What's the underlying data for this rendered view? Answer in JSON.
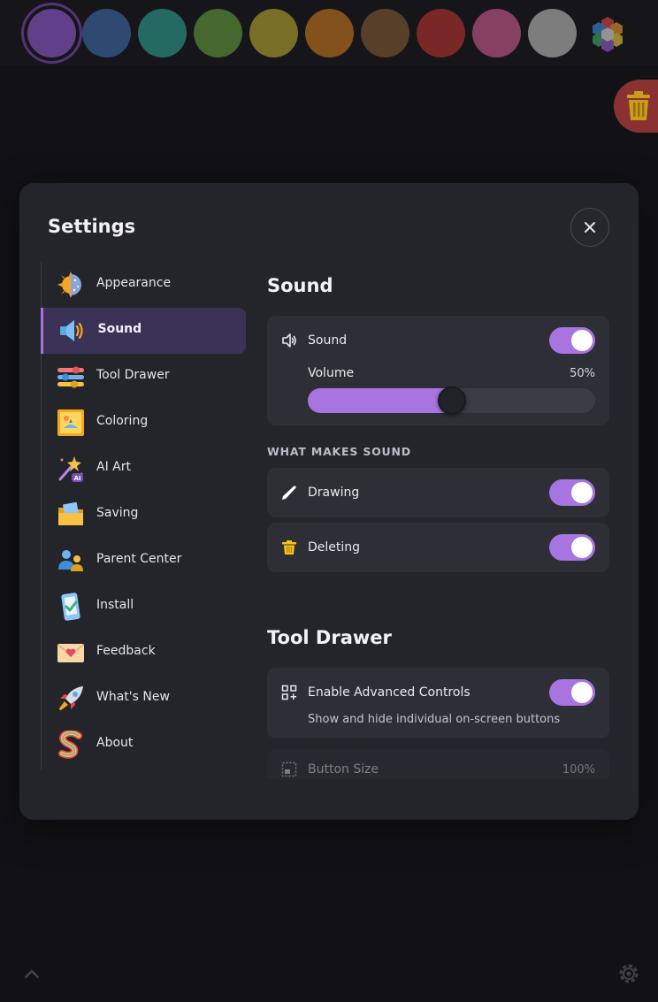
{
  "palette": {
    "swatches": [
      {
        "name": "purple",
        "color": "#7b4fae",
        "selected": true
      },
      {
        "name": "blue",
        "color": "#3d6aa8"
      },
      {
        "name": "teal",
        "color": "#2f9c92"
      },
      {
        "name": "green",
        "color": "#629b3c"
      },
      {
        "name": "yellow",
        "color": "#b5a52f"
      },
      {
        "name": "orange",
        "color": "#c7771f"
      },
      {
        "name": "brown",
        "color": "#7f5833"
      },
      {
        "name": "red",
        "color": "#b83232"
      },
      {
        "name": "pink",
        "color": "#cc5b8f"
      },
      {
        "name": "gray",
        "color": "#bdbdbd"
      }
    ]
  },
  "settings": {
    "title": "Settings",
    "nav": [
      {
        "label": "Appearance",
        "icon": "sun-moon-icon"
      },
      {
        "label": "Sound",
        "icon": "speaker-icon",
        "active": true
      },
      {
        "label": "Tool Drawer",
        "icon": "sliders-icon"
      },
      {
        "label": "Coloring",
        "icon": "picture-icon"
      },
      {
        "label": "AI Art",
        "icon": "magic-wand-icon"
      },
      {
        "label": "Saving",
        "icon": "folder-photo-icon"
      },
      {
        "label": "Parent Center",
        "icon": "parent-child-icon"
      },
      {
        "label": "Install",
        "icon": "phone-check-icon"
      },
      {
        "label": "Feedback",
        "icon": "envelope-heart-icon"
      },
      {
        "label": "What's New",
        "icon": "rocket-icon"
      },
      {
        "label": "About",
        "icon": "rainbow-s-icon"
      }
    ],
    "sound": {
      "title": "Sound",
      "sound_label": "Sound",
      "sound_on": true,
      "volume_label": "Volume",
      "volume_value": "50%",
      "volume_fraction": 0.5,
      "group_label": "WHAT MAKES SOUND",
      "drawing_label": "Drawing",
      "drawing_on": true,
      "deleting_label": "Deleting",
      "deleting_on": true
    },
    "tool_drawer": {
      "title": "Tool Drawer",
      "advanced_label": "Enable Advanced Controls",
      "advanced_sub": "Show and hide individual on-screen buttons",
      "advanced_on": true,
      "button_size_label": "Button Size",
      "button_size_value": "100%"
    }
  },
  "colors": {
    "accent": "#a774e0",
    "modal_bg": "#24242b",
    "card_bg": "#2e2e37",
    "fab_red": "#a83a3a"
  }
}
